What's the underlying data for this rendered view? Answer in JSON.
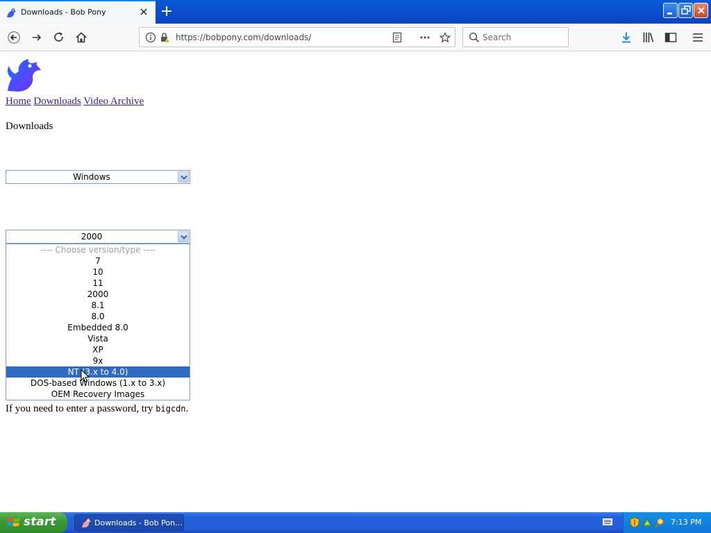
{
  "browser": {
    "tab_title": "Downloads - Bob Pony",
    "url": "https://bobpony.com/downloads/",
    "search_placeholder": "Search"
  },
  "page": {
    "nav_links": [
      "Home",
      "Downloads",
      "Video Archive"
    ],
    "heading": "Downloads",
    "os_select": {
      "value": "Windows"
    },
    "version_select": {
      "value": "2000",
      "options": [
        "---- Choose version/type ----",
        "7",
        "10",
        "11",
        "2000",
        "8.1",
        "8.0",
        "Embedded 8.0",
        "Vista",
        "XP",
        "9x",
        "NT (3.x to 4.0)",
        "DOS-based Windows (1.x to 3.x)",
        "OEM Recovery Images"
      ],
      "highlighted": "NT (3.x to 4.0)"
    },
    "password_prefix": "If you need to enter a password, try ",
    "password": "bigcdn",
    "password_suffix": "."
  },
  "taskbar": {
    "start_label": "start",
    "window_label": "Downloads - Bob Pon...",
    "clock": "7:13 PM"
  },
  "colors": {
    "selection": "#316ac5",
    "link": "#3b1f8c",
    "taskbar": "#245ddb",
    "start": "#3a9a35"
  }
}
